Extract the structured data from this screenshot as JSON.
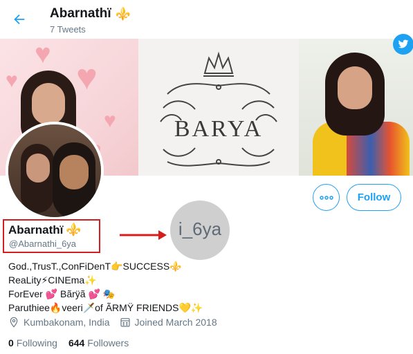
{
  "header": {
    "title": "Abarnathï",
    "title_emoji": "⚜️",
    "subtitle": "7 Tweets"
  },
  "banner": {
    "logo_text": "BARYA"
  },
  "actions": {
    "more_label": "More",
    "follow_label": "Follow"
  },
  "profile": {
    "name": "Abarnathï",
    "name_emoji": "⚜️",
    "handle": "@Abarnathi_6ya",
    "bio_lines": [
      "God.,TrusT.,ConFiDenT👉SUCCESS⚜️",
      "ReaLity⚡CINEma✨",
      "ForEver 💕 Bãrÿã 💕 🎭",
      "Paruthiee🔥veeri🗡️of ÃRMŸ FRIENDS💛✨"
    ],
    "location": "Kumbakonam, India",
    "joined": "Joined March 2018",
    "following_count": "0",
    "following_label": "Following",
    "followers_count": "644",
    "followers_label": "Followers"
  },
  "annotation": {
    "circle_text": "i_6ya"
  },
  "colors": {
    "accent": "#1da1f2",
    "annotation_red": "#d41d1d",
    "muted": "#657786"
  }
}
